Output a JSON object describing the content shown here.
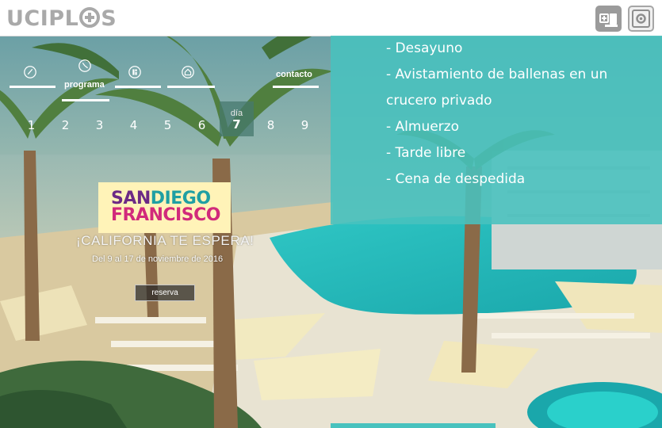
{
  "header": {
    "logo_prefix": "UCIPL",
    "logo_suffix": "S"
  },
  "nav": {
    "items": [
      {
        "label": "",
        "icon": "pen-icon"
      },
      {
        "label": "programa",
        "icon": "clock-icon"
      },
      {
        "label": "",
        "icon": "building-icon"
      },
      {
        "label": "",
        "icon": "home-icon"
      },
      {
        "label": "contacto",
        "icon": ""
      }
    ]
  },
  "days": {
    "day_word": "día",
    "numbers": [
      "1",
      "2",
      "3",
      "4",
      "5",
      "6",
      "7",
      "8",
      "9"
    ],
    "active": "7"
  },
  "promo": {
    "logo_san": "SAN",
    "logo_diego": "DIEGO",
    "logo_francisco": "FRANCISCO",
    "tagline": "¡CALIFORNIA TE ESPERA!",
    "dates": "Del 9 al 17 de noviembre de 2016",
    "reserve_label": "reserva"
  },
  "program": {
    "items": [
      "- Desayuno",
      "- Avistamiento de ballenas en un",
      "crucero privado",
      "- Almuerzo",
      "- Tarde libre",
      "- Cena de despedida"
    ]
  },
  "colors": {
    "panel": "#48c2be",
    "logo_gray": "#a9a9a9",
    "san": "#6c2a86",
    "diego": "#1f9fa3",
    "francisco": "#d12a7b"
  }
}
